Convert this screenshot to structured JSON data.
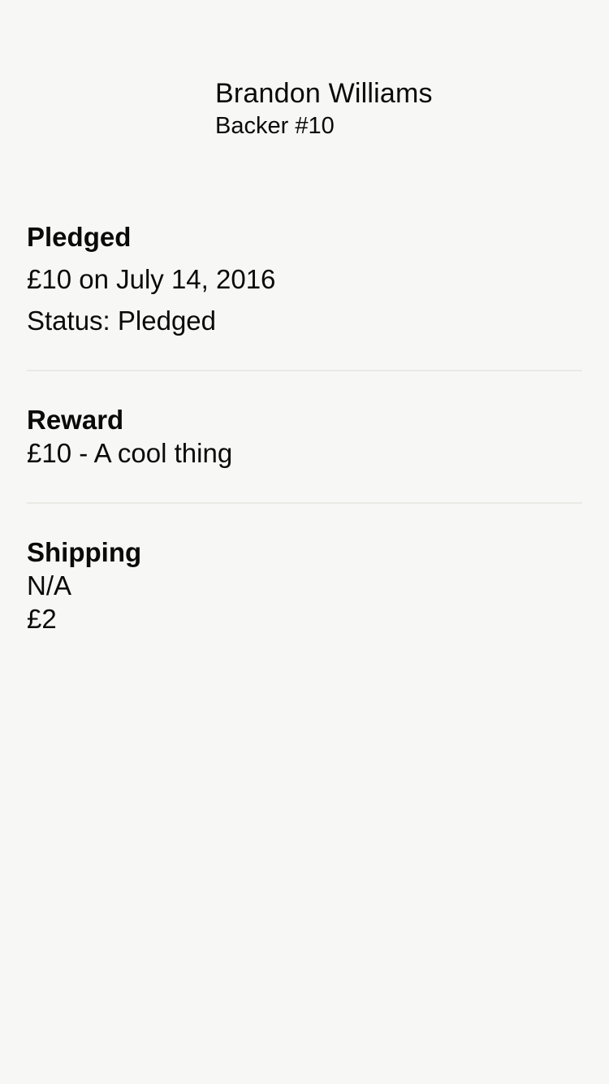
{
  "header": {
    "name": "Brandon Williams",
    "backer_number": "Backer #10"
  },
  "pledged": {
    "title": "Pledged",
    "amount_date": "£10 on July 14, 2016",
    "status": "Status: Pledged"
  },
  "reward": {
    "title": "Reward",
    "description": "£10 - A cool thing"
  },
  "shipping": {
    "title": "Shipping",
    "location": "N/A",
    "amount": "£2"
  }
}
